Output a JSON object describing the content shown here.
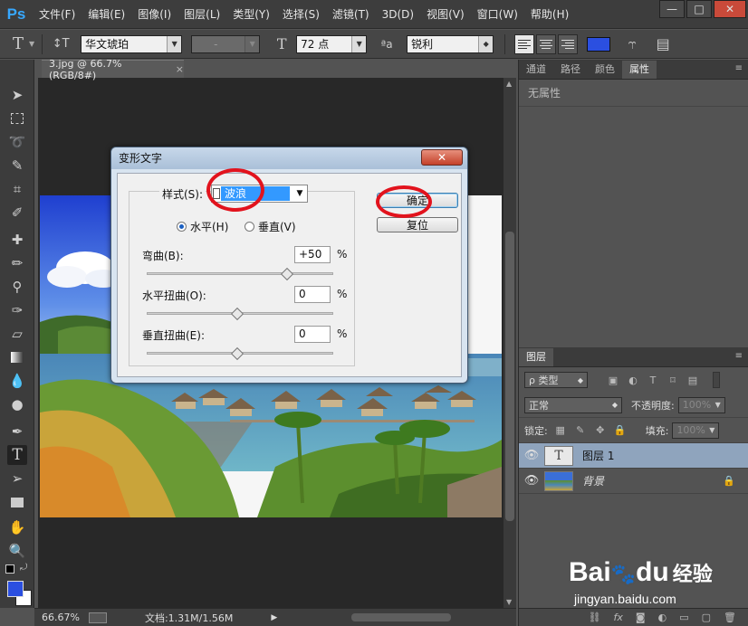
{
  "app": {
    "logo": "Ps"
  },
  "menu": [
    "文件(F)",
    "编辑(E)",
    "图像(I)",
    "图层(L)",
    "类型(Y)",
    "选择(S)",
    "滤镜(T)",
    "3D(D)",
    "视图(V)",
    "窗口(W)",
    "帮助(H)"
  ],
  "window_buttons": {
    "minimize": "—",
    "restore": "□",
    "close": "✕"
  },
  "options": {
    "tool_glyph": "T",
    "orient_glyph": "↕T",
    "font_family": "华文琥珀",
    "font_style": "-",
    "size_glyph": "T",
    "font_size": "72 点",
    "aa_glyph": "ªa",
    "antialias": "锐利",
    "text_color": "#2b4fe0"
  },
  "document": {
    "tab_title": "3.jpg @ 66.7%(RGB/8#)",
    "tab_close": "×",
    "zoom": "66.67%",
    "doc_info": "文档:1.31M/1.56M",
    "status_arrow": "▶"
  },
  "properties_panel": {
    "tabs": [
      "通道",
      "路径",
      "颜色",
      "属性"
    ],
    "active_tab": "属性",
    "empty_text": "无属性"
  },
  "layers_panel": {
    "tab": "图层",
    "filter_label": "ρ 类型",
    "blend_mode": "正常",
    "opacity_label": "不透明度:",
    "opacity_value": "100%",
    "lock_label": "锁定:",
    "fill_label": "填充:",
    "fill_value": "100%",
    "layers": [
      {
        "name": "图层 1",
        "type": "text",
        "thumb_glyph": "T",
        "selected": true
      },
      {
        "name": "背景",
        "type": "image",
        "selected": false,
        "locked": true
      }
    ]
  },
  "dialog": {
    "title": "变形文字",
    "close": "✕",
    "style_label": "样式(S):",
    "style_value": "波浪",
    "horizontal_label": "水平(H)",
    "vertical_label": "垂直(V)",
    "orientation": "horizontal",
    "bend_label": "弯曲(B):",
    "bend_value": "+50",
    "bend_level": 0.75,
    "h_distort_label": "水平扭曲(O):",
    "h_distort_value": "0",
    "v_distort_label": "垂直扭曲(E):",
    "v_distort_value": "0",
    "percent": "%",
    "ok": "确定",
    "reset": "复位"
  },
  "watermark": {
    "brand": "Bai",
    "brand2": "du",
    "tag": "经验",
    "url": "jingyan.baidu.com"
  }
}
